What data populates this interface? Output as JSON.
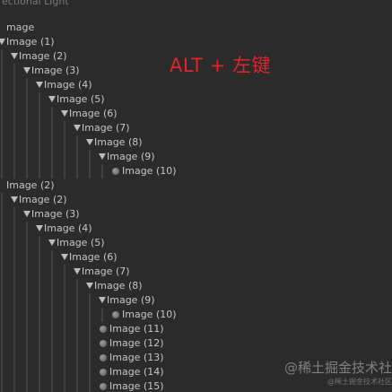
{
  "header": {
    "partial_label": "ectional Light"
  },
  "hierarchy": [
    {
      "label": "mage",
      "depth": 0,
      "kind": "none"
    },
    {
      "label": "Image (1)",
      "depth": 0,
      "kind": "toggle"
    },
    {
      "label": "Image (2)",
      "depth": 1,
      "kind": "toggle"
    },
    {
      "label": "Image (3)",
      "depth": 2,
      "kind": "toggle"
    },
    {
      "label": "Image (4)",
      "depth": 3,
      "kind": "toggle"
    },
    {
      "label": "Image (5)",
      "depth": 4,
      "kind": "toggle"
    },
    {
      "label": "Image (6)",
      "depth": 5,
      "kind": "toggle"
    },
    {
      "label": "Image (7)",
      "depth": 6,
      "kind": "toggle"
    },
    {
      "label": "Image (8)",
      "depth": 7,
      "kind": "toggle"
    },
    {
      "label": "Image (9)",
      "depth": 8,
      "kind": "toggle"
    },
    {
      "label": "Image (10)",
      "depth": 9,
      "kind": "leaf"
    },
    {
      "label": "Image (2)",
      "depth": 0,
      "kind": "none"
    },
    {
      "label": "Image (2)",
      "depth": 1,
      "kind": "toggle"
    },
    {
      "label": "Image (3)",
      "depth": 2,
      "kind": "toggle"
    },
    {
      "label": "Image (4)",
      "depth": 3,
      "kind": "toggle"
    },
    {
      "label": "Image (5)",
      "depth": 4,
      "kind": "toggle"
    },
    {
      "label": "Image (6)",
      "depth": 5,
      "kind": "toggle"
    },
    {
      "label": "Image (7)",
      "depth": 6,
      "kind": "toggle"
    },
    {
      "label": "Image (8)",
      "depth": 7,
      "kind": "toggle"
    },
    {
      "label": "Image (9)",
      "depth": 8,
      "kind": "toggle"
    },
    {
      "label": "Image (10)",
      "depth": 9,
      "kind": "leaf"
    },
    {
      "label": "Image (11)",
      "depth": 8,
      "kind": "leaf"
    },
    {
      "label": "Image (12)",
      "depth": 8,
      "kind": "leaf"
    },
    {
      "label": "Image (13)",
      "depth": 8,
      "kind": "leaf"
    },
    {
      "label": "Image (14)",
      "depth": 8,
      "kind": "leaf"
    },
    {
      "label": "Image (15)",
      "depth": 8,
      "kind": "leaf"
    }
  ],
  "annotation": {
    "text": "ALT + 左键",
    "color": "#e0232c"
  },
  "watermark": {
    "main": "@稀土掘金技术社",
    "sub": "@稀土掘金技术社区"
  },
  "colors": {
    "background": "#2b2b2b",
    "text": "#c6c6c6",
    "guide": "#555555"
  },
  "icons": {
    "expand": "triangle-down-icon",
    "leaf": "gameobject-sphere-icon"
  }
}
